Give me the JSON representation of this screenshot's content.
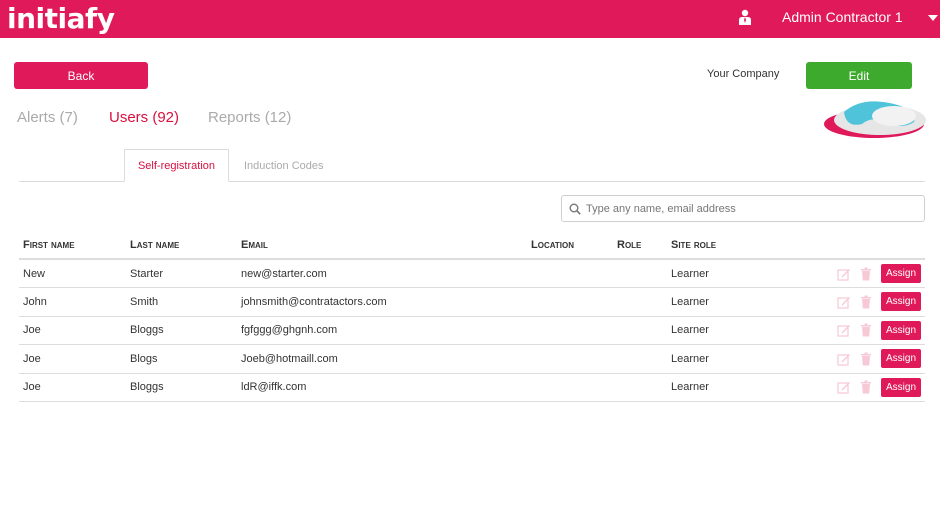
{
  "header": {
    "logo": "initiafy",
    "user_name": "Admin Contractor 1"
  },
  "actions": {
    "back_label": "Back",
    "company_name": "Your Company",
    "edit_label": "Edit"
  },
  "main_tabs": [
    {
      "label": "Alerts (7)",
      "active": false
    },
    {
      "label": "Users (92)",
      "active": true
    },
    {
      "label": "Reports (12)",
      "active": false
    }
  ],
  "sub_tabs": [
    {
      "label": "Self-registration",
      "active": true
    },
    {
      "label": "Induction Codes",
      "active": false
    }
  ],
  "search": {
    "placeholder": "Type any name, email address"
  },
  "table": {
    "columns": [
      "First name",
      "Last name",
      "Email",
      "Location",
      "Role",
      "Site role"
    ],
    "rows": [
      {
        "first": "New",
        "last": "Starter",
        "email": "new@starter.com",
        "location": "",
        "role": "",
        "site_role": "Learner"
      },
      {
        "first": "John",
        "last": "Smith",
        "email": "johnsmith@contratactors.com",
        "location": "",
        "role": "",
        "site_role": "Learner"
      },
      {
        "first": "Joe",
        "last": "Bloggs",
        "email": "fgfggg@ghgnh.com",
        "location": "",
        "role": "",
        "site_role": "Learner"
      },
      {
        "first": "Joe",
        "last": "Blogs",
        "email": "Joeb@hotmaill.com",
        "location": "",
        "role": "",
        "site_role": "Learner"
      },
      {
        "first": "Joe",
        "last": "Bloggs",
        "email": "ldR@iffk.com",
        "location": "",
        "role": "",
        "site_role": "Learner"
      }
    ],
    "assign_label": "Assign"
  },
  "colors": {
    "brand": "#e0195a",
    "edit_green": "#3daa2e",
    "active_tab": "#d8103f"
  }
}
